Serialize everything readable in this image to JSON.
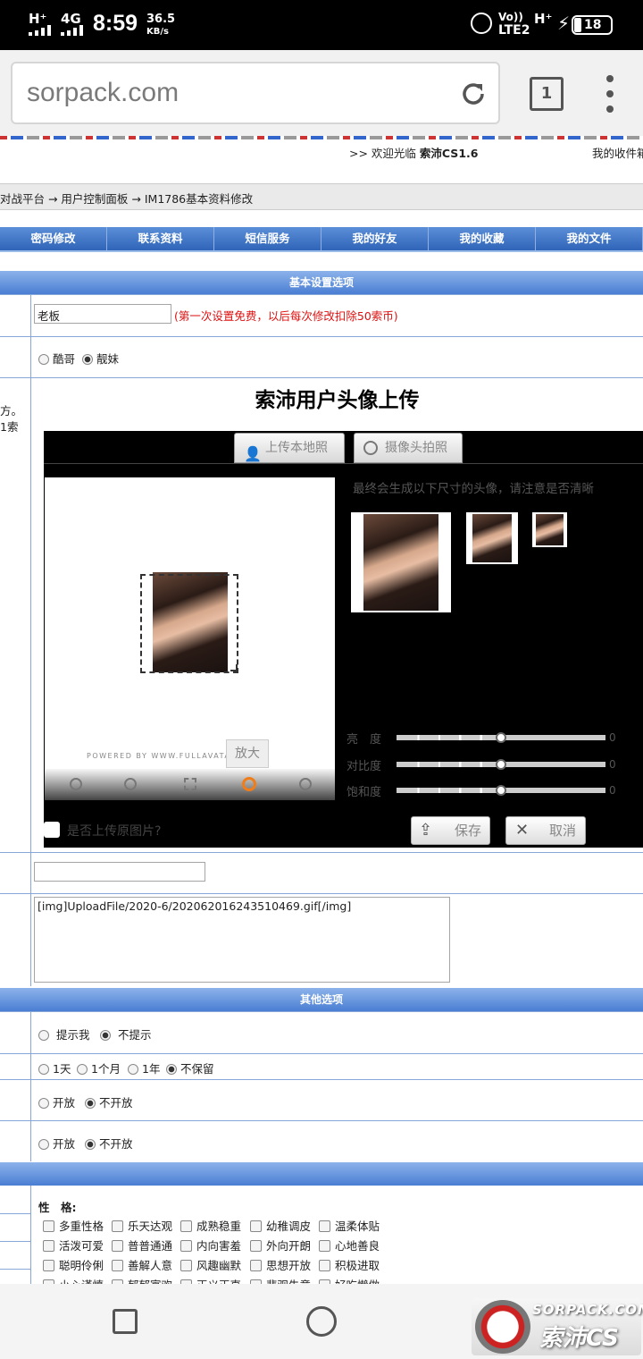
{
  "status": {
    "net1": "H⁺",
    "net2": "4G",
    "time": "8:59",
    "speed_top": "36.5",
    "speed_unit": "KB/s",
    "volte": "Vo))",
    "lte": "LTE2",
    "net3": "H⁺",
    "battery": "18"
  },
  "browser": {
    "url": "sorpack.com",
    "tab_count": "1"
  },
  "site": {
    "welcome": ">> 欢迎光临",
    "site_name": "索沛CS1.6",
    "inbox": "我的收件箱",
    "breadcrumb": "对战平台 → 用户控制面板 → IM1786基本资料修改"
  },
  "nav": [
    "密码修改",
    "联系资料",
    "短信服务",
    "我的好友",
    "我的收藏",
    "我的文件"
  ],
  "basic": {
    "header": "基本设置选项",
    "nickname_value": "老板",
    "nickname_note": "(第一次设置免费，以后每次修改扣除50索币)",
    "gender_male": "酷哥",
    "gender_female": "靓妹",
    "left_note_1": "方。",
    "left_note_2": "1索"
  },
  "avatar": {
    "title": "索沛用户头像上传",
    "tab_local": "上传本地照",
    "tab_camera": "摄像头拍照",
    "hint": "最终会生成以下尺寸的头像，请注意是否清晰",
    "powered": "POWERED BY WWW.FULLAVATAR.COM",
    "zoom_tip": "放大",
    "brightness": "亮　度",
    "contrast": "对比度",
    "saturation": "饱和度",
    "val": "0",
    "keep_original": "是否上传原图片?",
    "save": "保存",
    "cancel": "取消"
  },
  "signature_value": "[img]UploadFile/2020-6/202062016243510469.gif[/img]",
  "other": {
    "header": "其他选项",
    "opt1_a": "提示我",
    "opt1_b": "不提示",
    "opt2_a": "1天",
    "opt2_b": "1个月",
    "opt2_c": "1年",
    "opt2_d": "不保留",
    "opt3_a": "开放",
    "opt3_b": "不开放",
    "opt4_a": "开放",
    "opt4_b": "不开放"
  },
  "personality": {
    "label": "性　格:",
    "rows": [
      [
        "多重性格",
        "乐天达观",
        "成熟稳重",
        "幼稚调皮",
        "温柔体贴"
      ],
      [
        "活泼可爱",
        "普普通通",
        "内向害羞",
        "外向开朗",
        "心地善良"
      ],
      [
        "聪明伶俐",
        "善解人意",
        "风趣幽默",
        "思想开放",
        "积极进取"
      ],
      [
        "小心谨慎",
        "郁郁寡欢",
        "正义正直",
        "悲观失意",
        "好吃懒做"
      ]
    ]
  },
  "watermark": {
    "top": "SORPACK.COM",
    "bottom": "索沛CS"
  }
}
